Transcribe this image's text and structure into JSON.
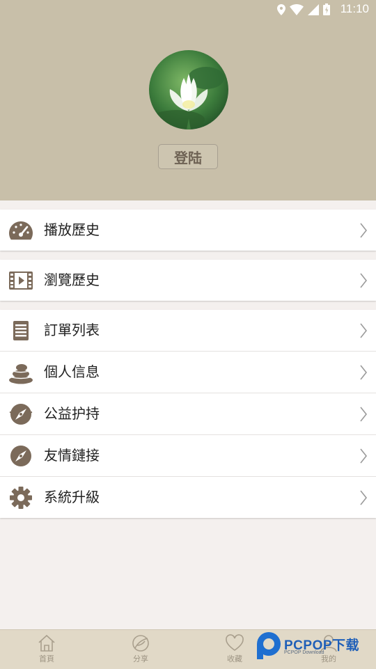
{
  "status": {
    "time": "11:10"
  },
  "header": {
    "login_label": "登陆"
  },
  "menu": {
    "group1": [
      {
        "label": "播放歷史",
        "icon": "speedometer-icon"
      }
    ],
    "group2": [
      {
        "label": "瀏覽歷史",
        "icon": "video-icon"
      }
    ],
    "group3": [
      {
        "label": "訂單列表",
        "icon": "list-icon"
      },
      {
        "label": "個人信息",
        "icon": "stones-icon"
      },
      {
        "label": "公益护持",
        "icon": "compass-icon"
      },
      {
        "label": "友情鏈接",
        "icon": "compass-icon"
      },
      {
        "label": "系統升級",
        "icon": "gear-icon"
      }
    ]
  },
  "tabbar": {
    "tabs": [
      {
        "label": "首頁",
        "icon": "home-icon"
      },
      {
        "label": "分享",
        "icon": "share-icon"
      },
      {
        "label": "收藏",
        "icon": "heart-icon"
      },
      {
        "label": "我的",
        "icon": "profile-icon"
      }
    ]
  },
  "watermark": {
    "brand": "PCPOP下载",
    "sub": "PCPOP Download"
  },
  "colors": {
    "header_bg": "#c8bfa9",
    "icon_brown": "#7b6a5a",
    "tabbar_bg": "#e1d9c7"
  }
}
